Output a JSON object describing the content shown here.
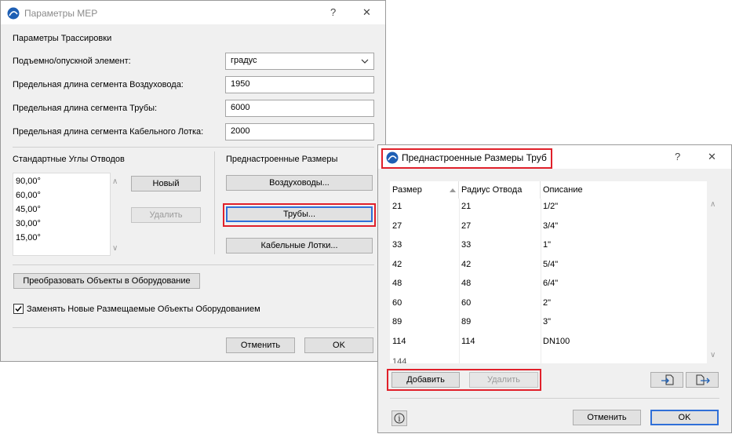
{
  "mep_dialog": {
    "title": "Параметры МЕР",
    "help": "?",
    "close": "✕",
    "section_title": "Параметры Трассировки",
    "rise_label": "Подъемно/опускной элемент:",
    "rise_value": "градус",
    "duct_label": "Предельная длина сегмента Воздуховода:",
    "duct_value": "1950",
    "pipe_label": "Предельная длина сегмента Трубы:",
    "pipe_value": "6000",
    "tray_label": "Предельная длина сегмента Кабельного Лотка:",
    "tray_value": "2000",
    "angles_title": "Стандартные Углы Отводов",
    "angles": [
      "90,00°",
      "60,00°",
      "45,00°",
      "30,00°",
      "15,00°"
    ],
    "new_button": "Новый",
    "delete_button": "Удалить",
    "presets_title": "Преднастроенные Размеры",
    "ducts_button": "Воздуховоды...",
    "pipes_button": "Трубы...",
    "trays_button": "Кабельные Лотки...",
    "convert_button": "Преобразовать Объекты в Оборудование",
    "replace_checkbox": "Заменять Новые Размещаемые Объекты Оборудованием",
    "replace_checked": true,
    "cancel_button": "Отменить",
    "ok_button": "OK"
  },
  "pipe_dialog": {
    "title": "Преднастроенные Размеры Труб",
    "help": "?",
    "close": "✕",
    "columns": [
      "Размер",
      "Радиус Отвода",
      "Описание"
    ],
    "rows": [
      [
        "21",
        "21",
        "1/2\""
      ],
      [
        "27",
        "27",
        "3/4\""
      ],
      [
        "33",
        "33",
        "1\""
      ],
      [
        "42",
        "42",
        "5/4\""
      ],
      [
        "48",
        "48",
        "6/4\""
      ],
      [
        "60",
        "60",
        "2\""
      ],
      [
        "89",
        "89",
        "3\""
      ],
      [
        "114",
        "114",
        "DN100"
      ]
    ],
    "add_button": "Добавить",
    "delete_button": "Удалить",
    "info": "i",
    "cancel_button": "Отменить",
    "ok_button": "OK"
  },
  "colors": {
    "highlight": "#e0202a",
    "focus": "#2f6fd8",
    "icon": "#1e5fb4"
  }
}
